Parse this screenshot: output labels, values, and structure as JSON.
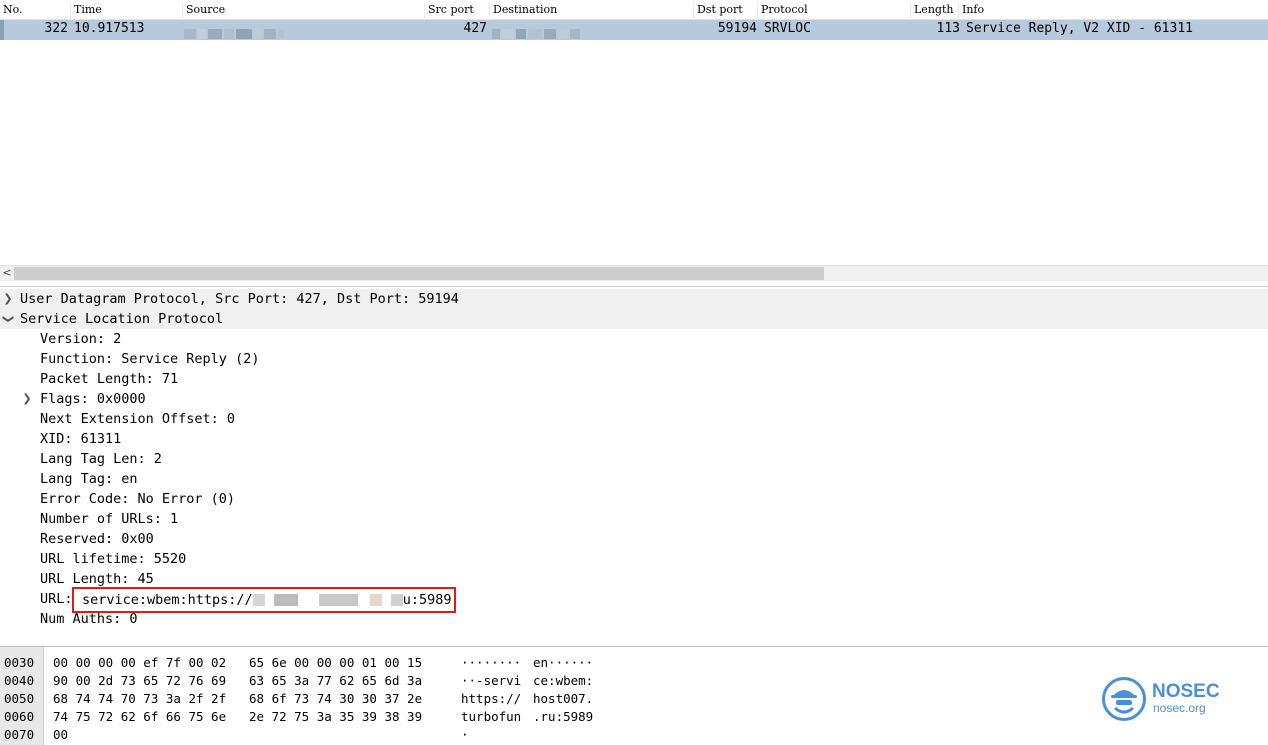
{
  "packet_list": {
    "columns": [
      "No.",
      "Time",
      "Source",
      "Src port",
      "Destination",
      "Dst port",
      "Protocol",
      "Length",
      "Info"
    ],
    "rows": [
      {
        "no": "322",
        "time": "10.917513",
        "src_port": "427",
        "dst_port": "59194",
        "protocol": "SRVLOC",
        "length": "113",
        "info": "Service Reply, V2 XID - 61311"
      }
    ]
  },
  "scrollbar": {
    "left_glyph": "<"
  },
  "detail_tree": {
    "udp": "User Datagram Protocol, Src Port: 427, Dst Port: 59194",
    "srvloc": "Service Location Protocol",
    "fields": [
      "Version: 2",
      "Function: Service Reply (2)",
      "Packet Length: 71",
      "Flags: 0x0000",
      "Next Extension Offset: 0",
      "XID: 61311",
      "Lang Tag Len: 2",
      "Lang Tag: en",
      "Error Code: No Error (0)",
      "Number of URLs: 1",
      "Reserved: 0x00",
      "URL lifetime: 5520",
      "URL Length: 45"
    ],
    "url_label": "URL:",
    "url_prefix": "service:wbem:https://",
    "url_suffix": "u:5989",
    "num_auths": "Num Auths: 0"
  },
  "hex_dump": [
    {
      "offset": "0030",
      "bytes_a": "00 00 00 00 ef 7f 00 02",
      "bytes_b": "65 6e 00 00 00 01 00 15",
      "ascii_a": "········",
      "ascii_b": "en······"
    },
    {
      "offset": "0040",
      "bytes_a": "90 00 2d 73 65 72 76 69",
      "bytes_b": "63 65 3a 77 62 65 6d 3a",
      "ascii_a": "··-servi",
      "ascii_b": "ce:wbem:"
    },
    {
      "offset": "0050",
      "bytes_a": "68 74 74 70 73 3a 2f 2f",
      "bytes_b": "68 6f 73 74 30 30 37 2e",
      "ascii_a": "https://",
      "ascii_b": "host007."
    },
    {
      "offset": "0060",
      "bytes_a": "74 75 72 62 6f 66 75 6e",
      "bytes_b": "2e 72 75 3a 35 39 38 39",
      "ascii_a": "turbofun",
      "ascii_b": ".ru:5989"
    },
    {
      "offset": "0070",
      "bytes_a": "00",
      "bytes_b": "",
      "ascii_a": "·",
      "ascii_b": ""
    }
  ],
  "watermark": {
    "name": "NOSEC",
    "url": "nosec.org"
  },
  "colors": {
    "selected_row": "#b7cadb",
    "highlight_box": "#e01b1b",
    "watermark": "#4a90d9"
  }
}
